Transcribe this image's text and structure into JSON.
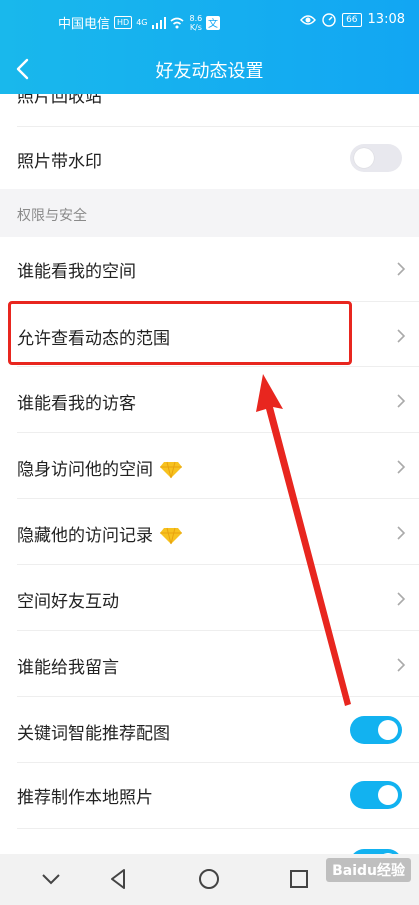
{
  "status_bar": {
    "carrier": "中国电信",
    "hd": "HD",
    "network": "4G",
    "speed_value": "8.6",
    "speed_unit": "K/s",
    "battery": "66",
    "time": "13:08"
  },
  "header": {
    "title": "好友动态设置"
  },
  "rows": {
    "photo_group_top": "照片回收站",
    "watermark": "照片带水印",
    "section_security": "权限与安全",
    "who_see_space": "谁能看我的空间",
    "allow_range": "允许查看动态的范围",
    "who_see_visitors": "谁能看我的访客",
    "invisible_visit": "隐身访问他的空间",
    "hide_visit_records": "隐藏他的访问记录",
    "space_friend_interaction": "空间好友互动",
    "who_leave_message": "谁能给我留言",
    "keyword_pictures": "关键词智能推荐配图",
    "recommend_local_photos": "推荐制作本地照片"
  },
  "toggles": {
    "watermark": false,
    "keyword_pictures": true,
    "recommend_local_photos": true
  },
  "colors": {
    "accent": "#12a6f3",
    "annotation": "#e8261f",
    "toggle_on": "#12b2f0"
  },
  "watermark_text": "Baidu经验"
}
